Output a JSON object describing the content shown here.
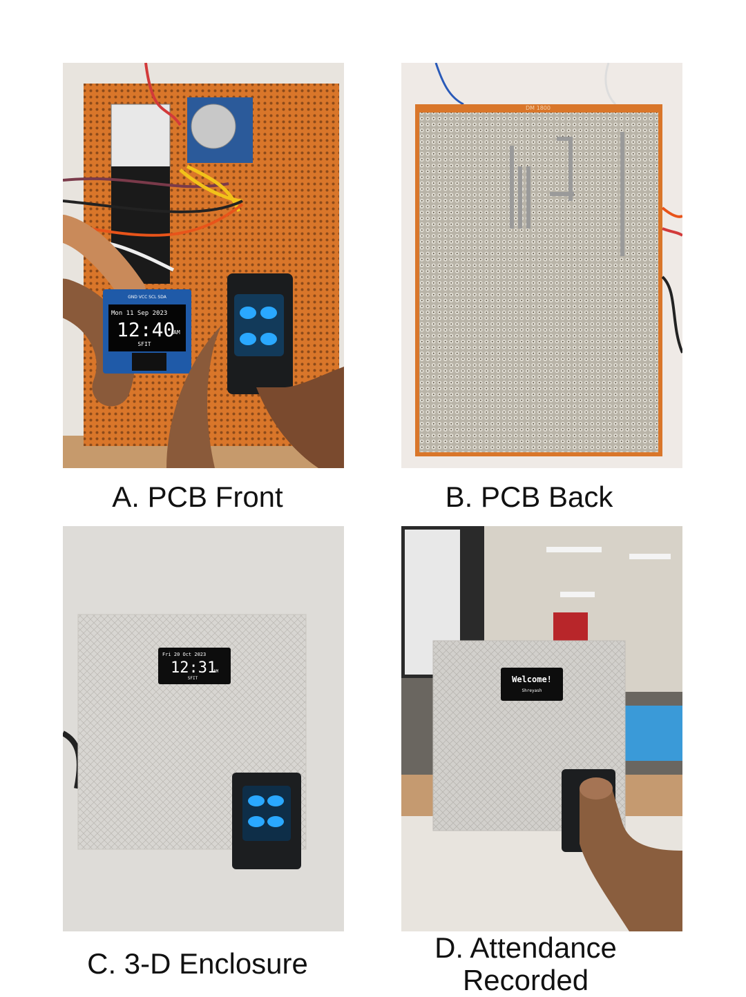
{
  "panels": [
    {
      "id": "A",
      "caption": "A. PCB Front",
      "oled": {
        "date": "Mon 11 Sep 2023",
        "time": "12:40",
        "ampm": "AM",
        "label": "SFIT",
        "pins": "GND VCC SCL SDA"
      }
    },
    {
      "id": "B",
      "caption": "B. PCB Back",
      "board_marking": "DM 1800"
    },
    {
      "id": "C",
      "caption": "C. 3-D Enclosure",
      "oled": {
        "date": "Fri 20 Oct 2023",
        "time": "12:31",
        "ampm": "AM",
        "label": "SFIT"
      }
    },
    {
      "id": "D",
      "caption_line1": "D. Attendance",
      "caption_line2": "Recorded",
      "oled": {
        "title": "Welcome!",
        "name": "Shreyash"
      }
    }
  ],
  "colors": {
    "pcb_orange": "#d9762a",
    "fingerprint_glow": "#2aa8ff",
    "enclosure": "#d8d6d2"
  }
}
